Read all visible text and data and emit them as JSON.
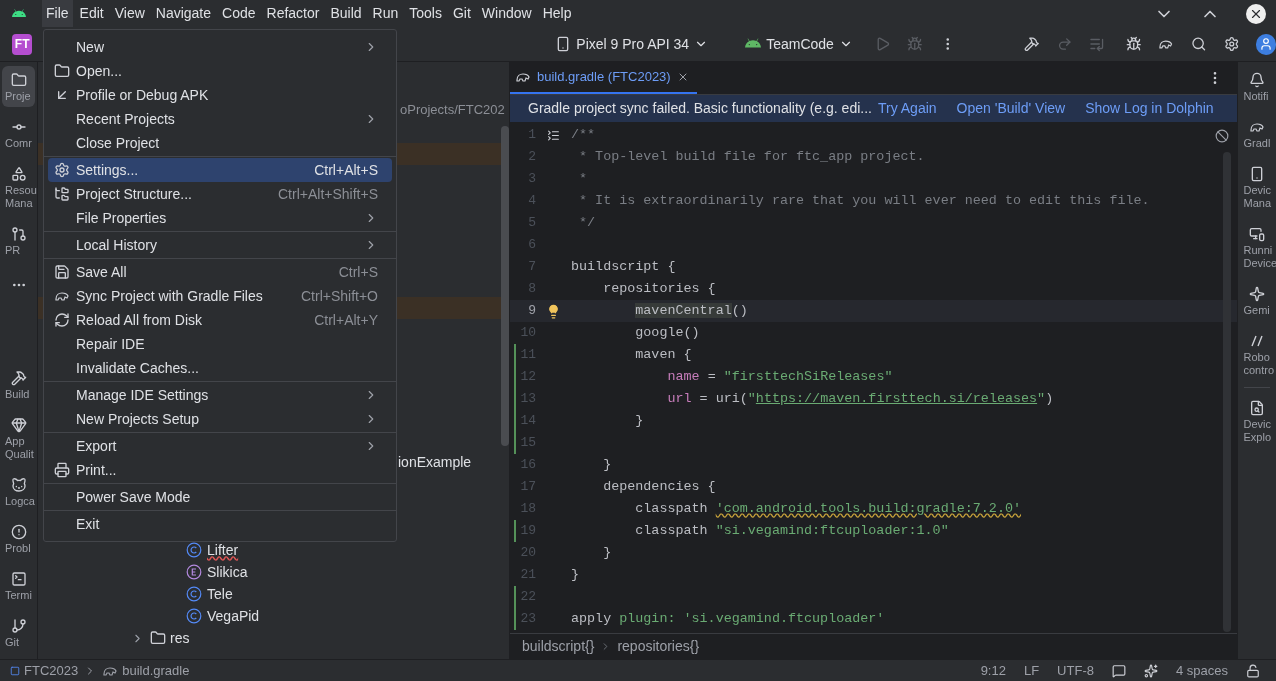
{
  "menu_bar": {
    "items": [
      {
        "label": "File",
        "selected": true
      },
      {
        "label": "Edit",
        "selected": false
      },
      {
        "label": "View",
        "selected": false
      },
      {
        "label": "Navigate",
        "selected": false
      },
      {
        "label": "Code",
        "selected": false
      },
      {
        "label": "Refactor",
        "selected": false
      },
      {
        "label": "Build",
        "selected": false
      },
      {
        "label": "Run",
        "selected": false
      },
      {
        "label": "Tools",
        "selected": false
      },
      {
        "label": "Git",
        "selected": false
      },
      {
        "label": "Window",
        "selected": false
      },
      {
        "label": "Help",
        "selected": false
      }
    ]
  },
  "toolbar": {
    "project_badge": "FT",
    "device": "Pixel 9 Pro API 34",
    "run_config": "TeamCode"
  },
  "left_tool_strip": {
    "top": [
      {
        "label_lines": [
          "Proje"
        ],
        "selected": true
      },
      {
        "label_lines": [
          "Comr"
        ],
        "selected": false
      },
      {
        "label_lines": [
          "Resou",
          "Mana"
        ],
        "selected": false
      },
      {
        "label_lines": [
          "PR"
        ],
        "selected": false
      }
    ],
    "bottom": [
      {
        "label_lines": [
          "Build"
        ],
        "selected": false
      },
      {
        "label_lines": [
          "App",
          "Qualit"
        ],
        "selected": false
      },
      {
        "label_lines": [
          "Logca"
        ],
        "selected": false
      },
      {
        "label_lines": [
          "Probl"
        ],
        "selected": false
      },
      {
        "label_lines": [
          "Termi"
        ],
        "selected": false
      },
      {
        "label_lines": [
          "Git"
        ],
        "selected": false
      }
    ]
  },
  "project_panel": {
    "path_fragment": "oProjects/FTC202",
    "item_fragment": "ionExample",
    "classes": [
      {
        "label": "Lifter",
        "kind": "class",
        "error": true
      },
      {
        "label": "Slikica",
        "kind": "enum",
        "error": false
      },
      {
        "label": "Tele",
        "kind": "class",
        "error": false
      },
      {
        "label": "VegaPid",
        "kind": "class",
        "error": false
      }
    ],
    "folders": [
      {
        "label": "res",
        "expanded": false
      }
    ]
  },
  "file_menu": {
    "items": [
      {
        "kind": "item",
        "label": "New",
        "submenu": true,
        "selected": false
      },
      {
        "kind": "item",
        "label": "Open...",
        "submenu": false,
        "selected": false
      },
      {
        "kind": "item",
        "label": "Profile or Debug APK",
        "submenu": false,
        "selected": false
      },
      {
        "kind": "item",
        "label": "Recent Projects",
        "submenu": true,
        "selected": false
      },
      {
        "kind": "item",
        "label": "Close Project",
        "submenu": false,
        "selected": false
      },
      {
        "kind": "separator"
      },
      {
        "kind": "item",
        "label": "Settings...",
        "shortcut": "Ctrl+Alt+S",
        "submenu": false,
        "selected": true
      },
      {
        "kind": "item",
        "label": "Project Structure...",
        "shortcut": "Ctrl+Alt+Shift+S",
        "submenu": false,
        "selected": false
      },
      {
        "kind": "item",
        "label": "File Properties",
        "submenu": true,
        "selected": false
      },
      {
        "kind": "separator"
      },
      {
        "kind": "item",
        "label": "Local History",
        "submenu": true,
        "selected": false
      },
      {
        "kind": "separator"
      },
      {
        "kind": "item",
        "label": "Save All",
        "shortcut": "Ctrl+S",
        "submenu": false,
        "selected": false
      },
      {
        "kind": "item",
        "label": "Sync Project with Gradle Files",
        "shortcut": "Ctrl+Shift+O",
        "submenu": false,
        "selected": false
      },
      {
        "kind": "item",
        "label": "Reload All from Disk",
        "shortcut": "Ctrl+Alt+Y",
        "submenu": false,
        "selected": false
      },
      {
        "kind": "item",
        "label": "Repair IDE",
        "submenu": false,
        "selected": false
      },
      {
        "kind": "item",
        "label": "Invalidate Caches...",
        "submenu": false,
        "selected": false
      },
      {
        "kind": "separator"
      },
      {
        "kind": "item",
        "label": "Manage IDE Settings",
        "submenu": true,
        "selected": false
      },
      {
        "kind": "item",
        "label": "New Projects Setup",
        "submenu": true,
        "selected": false
      },
      {
        "kind": "separator"
      },
      {
        "kind": "item",
        "label": "Export",
        "submenu": true,
        "selected": false
      },
      {
        "kind": "item",
        "label": "Print...",
        "submenu": false,
        "selected": false
      },
      {
        "kind": "separator"
      },
      {
        "kind": "item",
        "label": "Power Save Mode",
        "submenu": false,
        "selected": false
      },
      {
        "kind": "separator"
      },
      {
        "kind": "item",
        "label": "Exit",
        "submenu": false,
        "selected": false
      }
    ]
  },
  "editor": {
    "tab": {
      "label": "build.gradle (FTC2023)",
      "selected": true
    },
    "banner": {
      "message": "Gradle project sync failed. Basic functionality (e.g. edi...",
      "links": [
        "Try Again",
        "Open 'Build' View",
        "Show Log in Dolphin"
      ]
    },
    "lines": [
      {
        "number": "1",
        "kind": "fold",
        "selected": false,
        "changed": false,
        "tokens": [
          {
            "kind": "comment",
            "t": "/**"
          }
        ]
      },
      {
        "number": "2",
        "kind": "plain",
        "selected": false,
        "changed": false,
        "tokens": [
          {
            "kind": "comment",
            "t": " * Top-level build file for ftc_app project."
          }
        ]
      },
      {
        "number": "3",
        "kind": "plain",
        "selected": false,
        "changed": false,
        "tokens": [
          {
            "kind": "comment",
            "t": " *"
          }
        ]
      },
      {
        "number": "4",
        "kind": "plain",
        "selected": false,
        "changed": false,
        "tokens": [
          {
            "kind": "comment",
            "t": " * It is extraordinarily rare that you will ever need to edit this file."
          }
        ]
      },
      {
        "number": "5",
        "kind": "plain",
        "selected": false,
        "changed": false,
        "tokens": [
          {
            "kind": "comment",
            "t": " */"
          }
        ]
      },
      {
        "number": "6",
        "kind": "plain",
        "selected": false,
        "changed": false
      },
      {
        "number": "7",
        "kind": "plain",
        "selected": false,
        "changed": false,
        "tokens": [
          {
            "kind": "plain",
            "t": "buildscript {"
          }
        ]
      },
      {
        "number": "8",
        "kind": "plain",
        "selected": false,
        "changed": false,
        "tokens": [
          {
            "kind": "plain",
            "t": "    repositories {"
          }
        ]
      },
      {
        "number": "9",
        "kind": "bulb",
        "selected": true,
        "changed": false,
        "tokens": [
          {
            "kind": "highlight",
            "t": "        mavenCentral"
          },
          {
            "kind": "plain",
            "t": "()"
          }
        ]
      },
      {
        "number": "10",
        "kind": "plain",
        "selected": false,
        "changed": false,
        "tokens": [
          {
            "kind": "plain",
            "t": "        google()"
          }
        ]
      },
      {
        "number": "11",
        "kind": "plain",
        "selected": false,
        "changed": true,
        "tokens": [
          {
            "kind": "plain",
            "t": "        maven {"
          }
        ]
      },
      {
        "number": "12",
        "kind": "plain",
        "selected": false,
        "changed": true,
        "tokens": [
          {
            "kind": "prop",
            "t": "            name"
          },
          {
            "kind": "plain",
            "t": " = "
          },
          {
            "kind": "string",
            "t": "\"firsttechSiReleases\""
          }
        ]
      },
      {
        "number": "13",
        "kind": "plain",
        "selected": false,
        "changed": true,
        "tokens": [
          {
            "kind": "prop",
            "t": "            url"
          },
          {
            "kind": "plain",
            "t": " = uri("
          },
          {
            "kind": "string",
            "t": "\""
          },
          {
            "kind": "link",
            "t": "https://maven.firsttech.si/releases"
          },
          {
            "kind": "string",
            "t": "\""
          },
          {
            "kind": "plain",
            "t": ")"
          }
        ]
      },
      {
        "number": "14",
        "kind": "plain",
        "selected": false,
        "changed": true,
        "tokens": [
          {
            "kind": "plain",
            "t": "        }"
          }
        ]
      },
      {
        "number": "15",
        "kind": "plain",
        "selected": false,
        "changed": true
      },
      {
        "number": "16",
        "kind": "plain",
        "selected": false,
        "changed": false,
        "tokens": [
          {
            "kind": "plain",
            "t": "    }"
          }
        ]
      },
      {
        "number": "17",
        "kind": "plain",
        "selected": false,
        "changed": false,
        "tokens": [
          {
            "kind": "plain",
            "t": "    dependencies {"
          }
        ]
      },
      {
        "number": "18",
        "kind": "plain",
        "selected": false,
        "changed": false,
        "tokens": [
          {
            "kind": "plain",
            "t": "        classpath "
          },
          {
            "kind": "warning",
            "t": "'com.android.tools.build:gradle:7.2.0'"
          }
        ]
      },
      {
        "number": "19",
        "kind": "plain",
        "selected": false,
        "changed": true,
        "tokens": [
          {
            "kind": "plain",
            "t": "        classpath "
          },
          {
            "kind": "string",
            "t": "\"si.vegamind:ftcuploader:1.0\""
          }
        ]
      },
      {
        "number": "20",
        "kind": "plain",
        "selected": false,
        "changed": false,
        "tokens": [
          {
            "kind": "plain",
            "t": "    }"
          }
        ]
      },
      {
        "number": "21",
        "kind": "plain",
        "selected": false,
        "changed": false,
        "tokens": [
          {
            "kind": "plain",
            "t": "}"
          }
        ]
      },
      {
        "number": "22",
        "kind": "plain",
        "selected": false,
        "changed": true
      },
      {
        "number": "23",
        "kind": "plain",
        "selected": false,
        "changed": true,
        "tokens": [
          {
            "kind": "plain",
            "t": "apply "
          },
          {
            "kind": "string",
            "t": "plugin: "
          },
          {
            "kind": "string",
            "t": "'si.vegamind.ftcuploader'"
          }
        ]
      }
    ],
    "breadcrumb": [
      "buildscript{}",
      "repositories{}"
    ]
  },
  "right_tool_strip": [
    {
      "label_lines": [
        "Notifi"
      ],
      "selected": false
    },
    {
      "label_lines": [
        "Gradl"
      ],
      "selected": false
    },
    {
      "label_lines": [
        "Devic",
        "Mana"
      ],
      "selected": false
    },
    {
      "label_lines": [
        "Runni",
        "Device"
      ],
      "selected": false
    },
    {
      "label_lines": [
        "Gemi"
      ],
      "selected": false
    },
    {
      "label_lines": [
        "Robo",
        "contro"
      ],
      "selected": false
    },
    {
      "label_lines": [
        "Devic",
        "Explo"
      ],
      "selected": false
    }
  ],
  "status_bar": {
    "path": [
      "FTC2023",
      "build.gradle"
    ],
    "position": "9:12",
    "line_separator": "LF",
    "encoding": "UTF-8",
    "indent": "4 spaces"
  }
}
